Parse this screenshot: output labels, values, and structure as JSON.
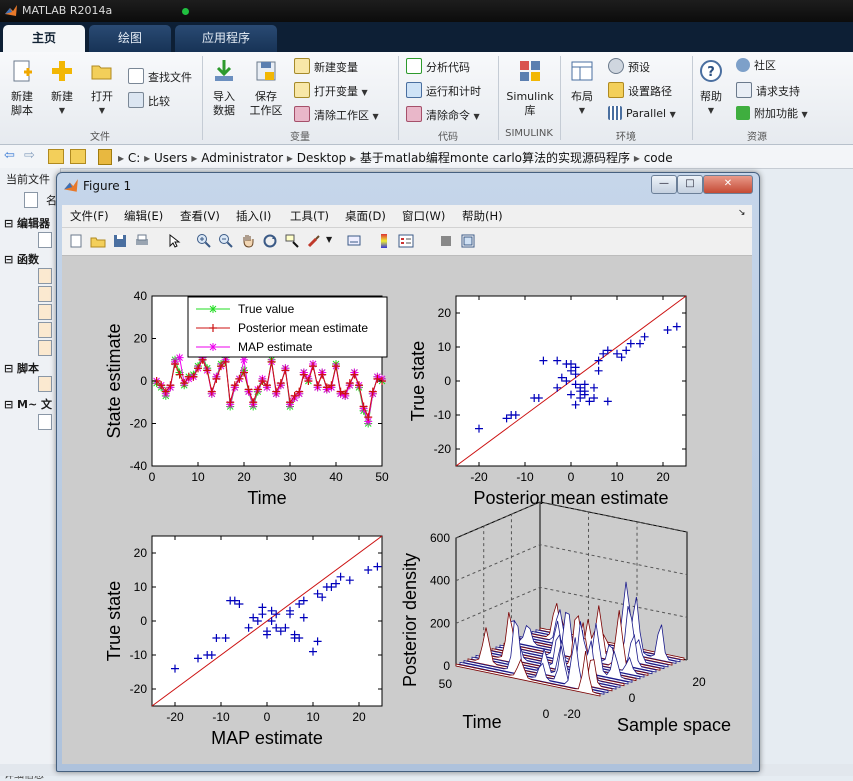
{
  "app": {
    "title": "MATLAB R2014a"
  },
  "tabs": [
    {
      "label": "主页",
      "active": true
    },
    {
      "label": "绘图",
      "active": false
    },
    {
      "label": "应用程序",
      "active": false
    }
  ],
  "ribbon": {
    "file": {
      "new_script": [
        "新建",
        "脚本"
      ],
      "new": "新建",
      "open": "打开",
      "find_files": "查找文件",
      "compare": "比较",
      "section": "文件"
    },
    "variable": {
      "import": [
        "导入",
        "数据"
      ],
      "save_workspace": [
        "保存",
        "工作区"
      ],
      "new_variable": "新建变量",
      "open_variable": "打开变量",
      "clear_workspace": "清除工作区",
      "section": "变量"
    },
    "code": {
      "analyze": "分析代码",
      "run_time": "运行和计时",
      "clear_commands": "清除命令",
      "section": "代码"
    },
    "simulink": {
      "library": [
        "Simulink",
        "库"
      ],
      "section": "SIMULINK"
    },
    "environment": {
      "layout": "布局",
      "preferences": "预设",
      "set_path": "设置路径",
      "parallel": "Parallel",
      "section": "环境"
    },
    "resources": {
      "help": "帮助",
      "community": "社区",
      "request_support": "请求支持",
      "addons": "附加功能",
      "section": "资源"
    }
  },
  "address": {
    "crumbs": [
      "C:",
      "Users",
      "Administrator",
      "Desktop",
      "基于matlab编程monte carlo算法的实现源码程序",
      "code"
    ]
  },
  "left_panel": {
    "header": "当前文件",
    "col_name": "名",
    "sections": [
      "编辑器",
      "函数",
      "脚本",
      "M~ 文"
    ],
    "bottom": "详细信息"
  },
  "figure": {
    "title": "Figure 1",
    "menu": [
      "文件(F)",
      "编辑(E)",
      "查看(V)",
      "插入(I)",
      "工具(T)",
      "桌面(D)",
      "窗口(W)",
      "帮助(H)"
    ],
    "window_buttons": {
      "minimize": "—",
      "maximize": "□",
      "close": "✕"
    }
  },
  "colors": {
    "true_value": "#22dd22",
    "posterior_mean": "#cc1111",
    "map": "#ee00ee",
    "scatter": "#0000bb",
    "ribbon_tab_bg": "#173356",
    "figure_frame": "#aec2dc"
  },
  "chart_data": [
    {
      "type": "line",
      "xlabel": "Time",
      "ylabel": "State estimate",
      "xlim": [
        0,
        50
      ],
      "ylim": [
        -40,
        40
      ],
      "xticks": [
        0,
        10,
        20,
        30,
        40,
        50
      ],
      "yticks": [
        -40,
        -20,
        0,
        20,
        40
      ],
      "legend": {
        "placement": "top-right"
      },
      "x": [
        1,
        2,
        3,
        4,
        5,
        6,
        7,
        8,
        9,
        10,
        11,
        12,
        13,
        14,
        15,
        16,
        17,
        18,
        19,
        20,
        21,
        22,
        23,
        24,
        25,
        26,
        27,
        28,
        29,
        30,
        31,
        32,
        33,
        34,
        35,
        36,
        37,
        38,
        39,
        40,
        41,
        42,
        43,
        44,
        45,
        46,
        47,
        48,
        49,
        50
      ],
      "series": [
        {
          "name": "True value",
          "marker": "*",
          "values": [
            -1,
            -3,
            -7,
            -3,
            10,
            4,
            -2,
            2,
            3,
            7,
            12,
            6,
            -6,
            2,
            8,
            11,
            -12,
            -3,
            1,
            5,
            -5,
            -12,
            -5,
            0,
            -3,
            10,
            -6,
            -2,
            6,
            -12,
            -8,
            -6,
            4,
            0,
            8,
            -3,
            4,
            -4,
            -3,
            8,
            -6,
            -7,
            -2,
            4,
            -3,
            -14,
            -20,
            -6,
            2,
            0
          ]
        },
        {
          "name": "Posterior mean estimate",
          "marker": "+",
          "values": [
            0,
            -2,
            -5,
            -2,
            8,
            3,
            -1,
            2,
            2,
            6,
            10,
            5,
            -5,
            1,
            7,
            9,
            -10,
            -2,
            1,
            4,
            -4,
            -10,
            -4,
            0,
            -2,
            9,
            -5,
            -1,
            5,
            -10,
            -7,
            -5,
            3,
            0,
            7,
            -2,
            3,
            -3,
            -2,
            7,
            -5,
            -6,
            -1,
            3,
            -2,
            -12,
            -17,
            -5,
            1,
            0
          ]
        },
        {
          "name": "MAP estimate",
          "marker": "*",
          "values": [
            0,
            -2,
            -6,
            -3,
            9,
            11,
            -1,
            1,
            2,
            6,
            11,
            5,
            -6,
            2,
            7,
            10,
            -11,
            -3,
            1,
            10,
            -5,
            -11,
            -4,
            1,
            -3,
            9,
            -6,
            -2,
            6,
            -11,
            -8,
            -6,
            4,
            1,
            8,
            -3,
            4,
            -4,
            -3,
            7,
            -6,
            -7,
            -2,
            4,
            -2,
            -13,
            -19,
            -6,
            2,
            1
          ]
        }
      ]
    },
    {
      "type": "scatter",
      "xlabel": "Posterior mean estimate",
      "ylabel": "True state",
      "xlim": [
        -25,
        25
      ],
      "ylim": [
        -25,
        25
      ],
      "xticks": [
        -20,
        -10,
        0,
        10,
        20
      ],
      "yticks": [
        -20,
        -10,
        0,
        10,
        20
      ],
      "reference_line": "y = x",
      "points": [
        [
          -20,
          -14
        ],
        [
          -14,
          -11
        ],
        [
          -13,
          -10
        ],
        [
          -12,
          -10
        ],
        [
          -8,
          -5
        ],
        [
          -7,
          -5
        ],
        [
          -6,
          6
        ],
        [
          -3,
          6
        ],
        [
          -3,
          -2
        ],
        [
          -2,
          1
        ],
        [
          -1,
          0
        ],
        [
          -1,
          5
        ],
        [
          0,
          -4
        ],
        [
          0,
          3
        ],
        [
          0,
          5
        ],
        [
          1,
          4
        ],
        [
          1,
          -7
        ],
        [
          1,
          -1
        ],
        [
          1,
          2
        ],
        [
          2,
          -2
        ],
        [
          2,
          -3
        ],
        [
          2,
          -5
        ],
        [
          3,
          -4
        ],
        [
          3,
          -3
        ],
        [
          3,
          -1
        ],
        [
          4,
          -6
        ],
        [
          5,
          -2
        ],
        [
          5,
          -5
        ],
        [
          6,
          3
        ],
        [
          6,
          6
        ],
        [
          7,
          8
        ],
        [
          8,
          -6
        ],
        [
          8,
          9
        ],
        [
          10,
          8
        ],
        [
          11,
          7
        ],
        [
          12,
          9
        ],
        [
          13,
          11
        ],
        [
          15,
          11
        ],
        [
          16,
          13
        ],
        [
          21,
          15
        ],
        [
          23,
          16
        ]
      ]
    },
    {
      "type": "scatter",
      "xlabel": "MAP estimate",
      "ylabel": "True state",
      "xlim": [
        -25,
        25
      ],
      "ylim": [
        -25,
        25
      ],
      "xticks": [
        -20,
        -10,
        0,
        10,
        20
      ],
      "yticks": [
        -20,
        -10,
        0,
        10,
        20
      ],
      "reference_line": "y = x",
      "points": [
        [
          -20,
          -14
        ],
        [
          -15,
          -11
        ],
        [
          -13,
          -10
        ],
        [
          -12,
          -10
        ],
        [
          -11,
          -5
        ],
        [
          -9,
          -5
        ],
        [
          -8,
          6
        ],
        [
          -7,
          6
        ],
        [
          -6,
          5
        ],
        [
          -4,
          -2
        ],
        [
          -3,
          1
        ],
        [
          -2,
          0
        ],
        [
          -1,
          4
        ],
        [
          -1,
          2
        ],
        [
          0,
          -3
        ],
        [
          0,
          -4
        ],
        [
          1,
          0
        ],
        [
          1,
          3
        ],
        [
          2,
          -2
        ],
        [
          2,
          2
        ],
        [
          3,
          -3
        ],
        [
          4,
          -2
        ],
        [
          5,
          2
        ],
        [
          5,
          3
        ],
        [
          6,
          -4
        ],
        [
          6,
          -5
        ],
        [
          7,
          5
        ],
        [
          7,
          -5
        ],
        [
          8,
          6
        ],
        [
          8,
          1
        ],
        [
          10,
          -9
        ],
        [
          11,
          -6
        ],
        [
          11,
          8
        ],
        [
          12,
          7
        ],
        [
          13,
          10
        ],
        [
          14,
          10
        ],
        [
          15,
          11
        ],
        [
          16,
          13
        ],
        [
          18,
          12
        ],
        [
          22,
          15
        ],
        [
          24,
          16
        ]
      ]
    },
    {
      "type": "area",
      "subtype": "3d-waterfall",
      "xlabel": "Time",
      "ylabel": "Sample space",
      "zlabel": "Posterior density",
      "zticks": [
        0,
        200,
        400,
        600
      ],
      "time_ticks": [
        0,
        50
      ],
      "sample_ticks": [
        -20,
        0,
        20
      ]
    }
  ]
}
